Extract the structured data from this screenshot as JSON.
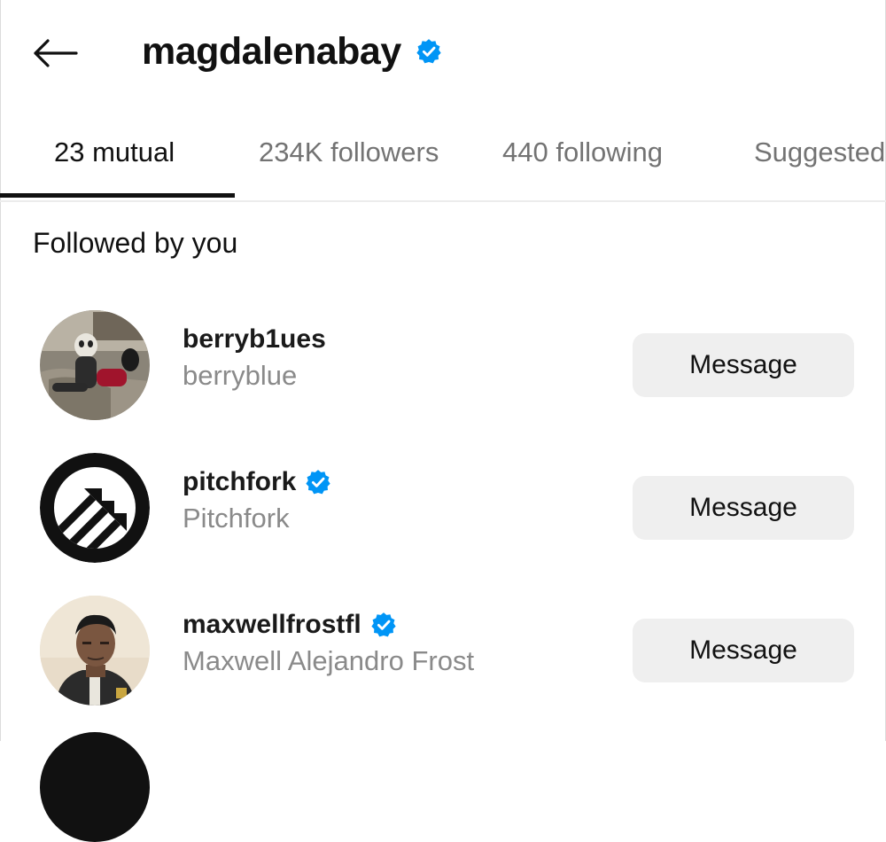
{
  "header": {
    "title": "magdalenabay",
    "verified": true,
    "back_icon": "arrow-left-icon"
  },
  "tabs": [
    {
      "label": "23 mutual",
      "active": true
    },
    {
      "label": "234K followers",
      "active": false
    },
    {
      "label": "440 following",
      "active": false
    },
    {
      "label": "Suggested",
      "active": false
    }
  ],
  "section": {
    "title": "Followed by you"
  },
  "accounts": [
    {
      "username": "berryb1ues",
      "name": "berryblue",
      "verified": false,
      "button": "Message"
    },
    {
      "username": "pitchfork",
      "name": "Pitchfork",
      "verified": true,
      "button": "Message"
    },
    {
      "username": "maxwellfrostfl",
      "name": "Maxwell Alejandro Frost",
      "verified": true,
      "button": "Message"
    }
  ],
  "colors": {
    "verified_blue": "#0095f6",
    "secondary_text": "#8a8a8a",
    "button_bg": "#efefef",
    "tab_inactive": "#737373"
  }
}
